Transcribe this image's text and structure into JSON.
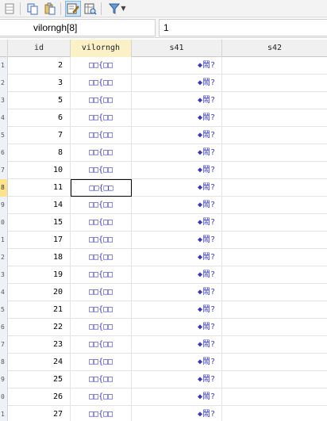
{
  "toolbar": {
    "buttons": [
      "copy-icon",
      "paste-icon",
      "edit-icon",
      "browse-icon",
      "filter-icon"
    ]
  },
  "editbar": {
    "variable_name": "vilorngh[8]",
    "value": "1"
  },
  "grid": {
    "columns": [
      {
        "key": "id",
        "label": "id"
      },
      {
        "key": "vilorngh",
        "label": "vilorngh"
      },
      {
        "key": "s41",
        "label": "s41"
      },
      {
        "key": "s42",
        "label": "s42"
      }
    ],
    "selected_column": "vilorngh",
    "active_row_index": 7,
    "rows": [
      {
        "obs": "1",
        "id": "2",
        "vilorngh": "□□{□□",
        "s41": "◆鬧?"
      },
      {
        "obs": "2",
        "id": "3",
        "vilorngh": "□□{□□",
        "s41": "◆鬧?"
      },
      {
        "obs": "3",
        "id": "5",
        "vilorngh": "□□{□□",
        "s41": "◆鬧?"
      },
      {
        "obs": "4",
        "id": "6",
        "vilorngh": "□□{□□",
        "s41": "◆鬧?"
      },
      {
        "obs": "5",
        "id": "7",
        "vilorngh": "□□{□□",
        "s41": "◆鬧?"
      },
      {
        "obs": "6",
        "id": "8",
        "vilorngh": "□□{□□",
        "s41": "◆鬧?"
      },
      {
        "obs": "7",
        "id": "10",
        "vilorngh": "□□{□□",
        "s41": "◆鬧?"
      },
      {
        "obs": "8",
        "id": "11",
        "vilorngh": "□□{□□",
        "s41": "◆鬧?"
      },
      {
        "obs": "9",
        "id": "14",
        "vilorngh": "□□{□□",
        "s41": "◆鬧?"
      },
      {
        "obs": "0",
        "id": "15",
        "vilorngh": "□□{□□",
        "s41": "◆鬧?"
      },
      {
        "obs": "1",
        "id": "17",
        "vilorngh": "□□{□□",
        "s41": "◆鬧?"
      },
      {
        "obs": "2",
        "id": "18",
        "vilorngh": "□□{□□",
        "s41": "◆鬧?"
      },
      {
        "obs": "3",
        "id": "19",
        "vilorngh": "□□{□□",
        "s41": "◆鬧?"
      },
      {
        "obs": "4",
        "id": "20",
        "vilorngh": "□□{□□",
        "s41": "◆鬧?"
      },
      {
        "obs": "5",
        "id": "21",
        "vilorngh": "□□{□□",
        "s41": "◆鬧?"
      },
      {
        "obs": "6",
        "id": "22",
        "vilorngh": "□□{□□",
        "s41": "◆鬧?"
      },
      {
        "obs": "7",
        "id": "23",
        "vilorngh": "□□{□□",
        "s41": "◆鬧?"
      },
      {
        "obs": "8",
        "id": "24",
        "vilorngh": "□□{□□",
        "s41": "◆鬧?"
      },
      {
        "obs": "9",
        "id": "25",
        "vilorngh": "□□{□□",
        "s41": "◆鬧?"
      },
      {
        "obs": "0",
        "id": "26",
        "vilorngh": "□□{□□",
        "s41": "◆鬧?"
      },
      {
        "obs": "1",
        "id": "27",
        "vilorngh": "□□{□□",
        "s41": "◆鬧?"
      }
    ]
  }
}
